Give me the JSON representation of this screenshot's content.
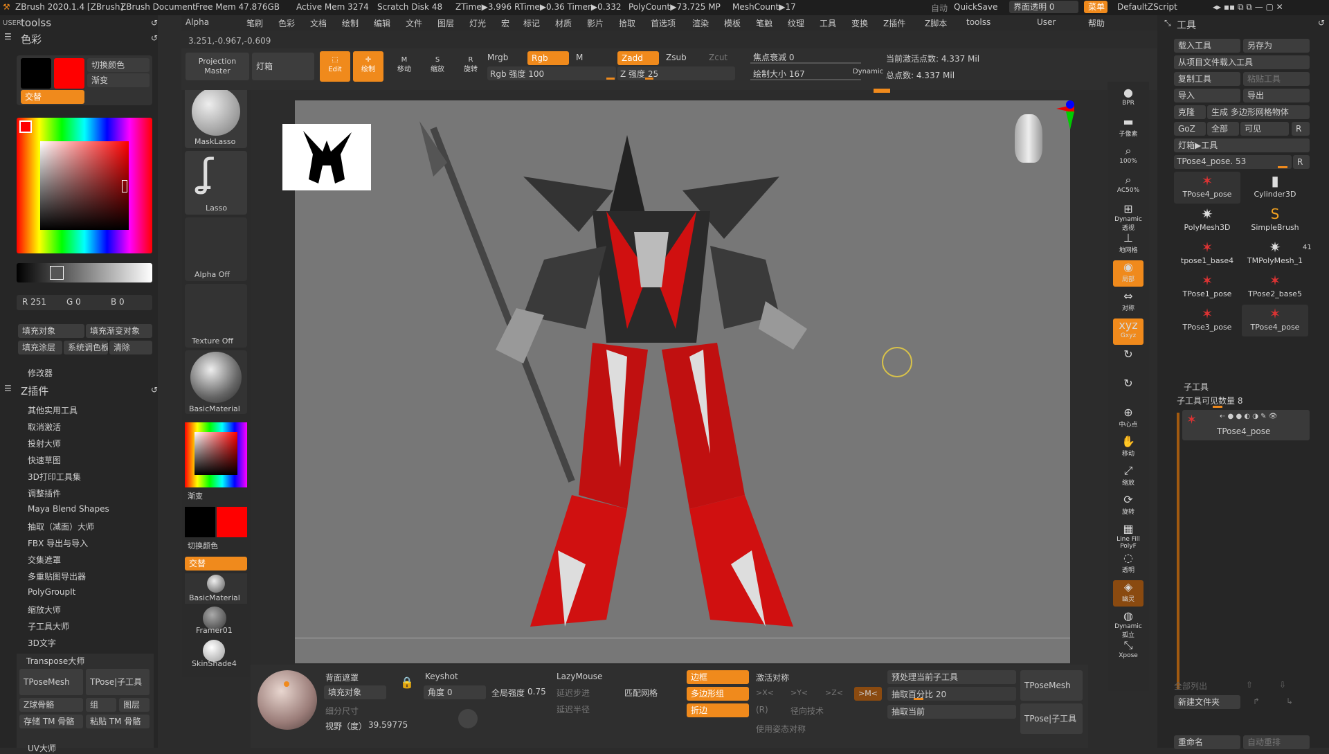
{
  "top_bar": {
    "app_title": "ZBrush 2020.1.4 [ZBrush]",
    "document": "ZBrush Document",
    "free_mem": "Free Mem 47.876GB",
    "active_mem": "Active Mem 3274",
    "scratch_disk": "Scratch Disk 48",
    "ztime": "ZTime▶3.996 RTime▶0.36 Timer▶0.332",
    "polycount": "PolyCount▶73.725 MP",
    "meshcount": "MeshCount▶17",
    "auto": "自动",
    "quicksave": "QuickSave",
    "transparency": "界面透明 0",
    "menu": "菜单",
    "script": "DefaultZScript"
  },
  "menu_items": [
    "Alpha",
    "笔刷",
    "色彩",
    "文档",
    "绘制",
    "编辑",
    "文件",
    "图层",
    "灯光",
    "宏",
    "标记",
    "材质",
    "影片",
    "拾取",
    "首选项",
    "渲染",
    "模板",
    "笔触",
    "纹理",
    "工具",
    "变换",
    "Z插件",
    "Z脚本",
    "toolss",
    "User",
    "帮助"
  ],
  "coords": "3.251,-0.967,-0.609",
  "left_panel": {
    "toolss": "toolss",
    "user_tag": "USER",
    "color_title": "色彩",
    "switch_color": "切换颜色",
    "gradient": "渐变",
    "alternate": "交替",
    "rgb": {
      "r": "R 251",
      "g": "G 0",
      "b": "B 0"
    },
    "fill_object": "填充对象",
    "fill_gradient_object": "填充渐变对象",
    "fill_layer": "填充涂层",
    "system_color": "系统调色板",
    "clear": "清除",
    "modifier": "修改器",
    "zplugin_title": "Z插件",
    "plugins": [
      "其他实用工具",
      "取消激活",
      "投射大师",
      "快速草图",
      "3D打印工具集",
      "调整插件",
      "Maya Blend Shapes",
      "抽取（减面）大师",
      "FBX 导出与导入",
      "交集遮罩",
      "多重贴图导出器",
      "PolyGroupIt",
      "缩放大师",
      "子工具大师",
      "3D文字"
    ],
    "transpose_master": "Transpose大师",
    "tposemesh": "TPoseMesh",
    "tpose_subtool": "TPose|子工具",
    "z_skeleton": "Z球骨骼",
    "group": "组",
    "layer": "图层",
    "save_tm_skeleton": "存储 TM 骨骼",
    "paste_tm_skeleton": "粘贴 TM 骨骼",
    "uv": "UV大师"
  },
  "tool_strip": {
    "projection_master": "Projection Master",
    "lightbox": "灯箱",
    "mask_lasso": "MaskLasso",
    "lasso": "Lasso",
    "alpha_off": "Alpha Off",
    "texture_off": "Texture Off",
    "basic_material": "BasicMaterial",
    "gradient": "渐变",
    "switch_color": "切换颜色",
    "alternate": "交替",
    "basic_material2": "BasicMaterial",
    "framer": "Framer01",
    "skinshade": "SkinShade4"
  },
  "toolbar": {
    "edit": "Edit",
    "draw": "绘制",
    "move": "移动",
    "scale": "缩放",
    "rotate": "旋转",
    "mrgb": "Mrgb",
    "rgb": "Rgb",
    "m": "M",
    "rgb_intensity": "Rgb 强度 100",
    "zadd": "Zadd",
    "zsub": "Zsub",
    "zcut": "Zcut",
    "z_intensity": "Z 强度 25",
    "focal_shift": "焦点衰减 0",
    "draw_size": "绘制大小 167",
    "dynamic": "Dynamic",
    "active_points": "当前激活点数: 4.337 Mil",
    "total_points": "总点数: 4.337 Mil"
  },
  "right_strip": [
    "BPR",
    "子像素",
    "100%",
    "AC50%",
    "Dynamic 透视",
    "地网格",
    "局部",
    "对称",
    "Gxyz",
    "",
    "",
    "中心点",
    "移动",
    "缩放",
    "旋转",
    "Line Fill PolyF",
    "透明",
    "幽灵",
    "Dynamic 孤立",
    "Xpose"
  ],
  "right_panel": {
    "title": "工具",
    "load_tool": "载入工具",
    "save_as": "另存为",
    "load_from_project": "从项目文件载入工具",
    "copy_tool": "复制工具",
    "paste_tool": "粘贴工具",
    "import": "导入",
    "export": "导出",
    "clone": "克隆",
    "make_polymesh": "生成 多边形网格物体",
    "goz": "GoZ",
    "all": "全部",
    "visible": "可见",
    "r": "R",
    "lightbox_tools": "灯箱▶工具",
    "current_tool": "TPose4_pose. 53",
    "tools": [
      {
        "name": "TPose4_pose",
        "icon": "figure"
      },
      {
        "name": "Cylinder3D",
        "icon": "cylinder"
      },
      {
        "name": "PolyMesh3D",
        "icon": "star"
      },
      {
        "name": "SimpleBrush",
        "icon": "s"
      },
      {
        "name": "tpose1_base4",
        "icon": "figure"
      },
      {
        "name": "TMPolyMesh_1",
        "icon": "star"
      },
      {
        "name": "TPose1_pose",
        "icon": "figure"
      },
      {
        "name": "TPose2_base5",
        "icon": "figure"
      },
      {
        "name": "TPose3_pose",
        "icon": "figure"
      },
      {
        "name": "TPose4_pose",
        "icon": "figure"
      }
    ],
    "count_41": "41",
    "subtool": "子工具",
    "subtool_visible": "子工具可见数量 8",
    "subtool_item": "TPose4_pose",
    "list_all": "全部列出",
    "new_folder": "新建文件夹",
    "rename": "重命名",
    "auto_reorder": "自动重排"
  },
  "bottom_bar": {
    "back_mask": "背面遮罩",
    "fill_object": "填充对象",
    "detail_size": "细分尺寸",
    "fov": "视野（度）",
    "fov_value": "39.59775",
    "keyshot": "Keyshot",
    "angle": "角度 0",
    "global_intensity": "全局强度",
    "global_intensity_value": "0.75",
    "lazymouse": "LazyMouse",
    "lazy_step": "延迟步进",
    "lazy_radius": "延迟半径",
    "match_mesh": "匹配网格",
    "frame": "边框",
    "polygroup": "多边形组",
    "crease": "折边",
    "activate_symmetry": "激活对称",
    "x": ">X<",
    "y": ">Y<",
    "z": ">Z<",
    "m": ">M<",
    "r": "(R)",
    "radial": "径向技术",
    "use_pose_symmetry": "使用姿态对称",
    "preprocess_subtool": "预处理当前子工具",
    "extract_percent": "抽取百分比 20",
    "extract_current": "抽取当前",
    "tposemesh": "TPoseMesh",
    "tpose_subtool": "TPose|子工具"
  },
  "colors": {
    "accent_orange": "#f08a1c",
    "primary_red": "#ff0000",
    "canvas_gray": "#777777"
  }
}
